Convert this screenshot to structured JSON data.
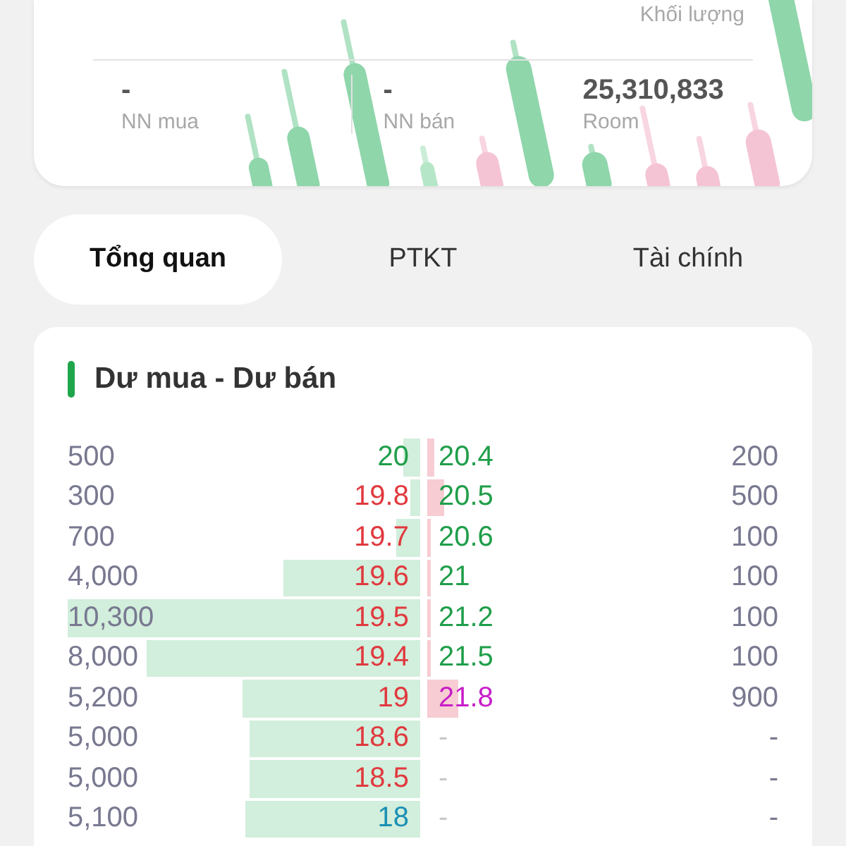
{
  "summary_card": {
    "volume_label": "Khối lượng",
    "stats": [
      {
        "value": "-",
        "label": "NN mua"
      },
      {
        "value": "-",
        "label": "NN bán"
      },
      {
        "value": "25,310,833",
        "label": "Room"
      }
    ]
  },
  "tabs": [
    {
      "label": "Tổng quan",
      "selected": true
    },
    {
      "label": "PTKT",
      "selected": false
    },
    {
      "label": "Tài chính",
      "selected": false
    }
  ],
  "order_book": {
    "title": "Dư mua - Dư bán",
    "rows": [
      {
        "bid": {
          "volume": "500",
          "price": "20",
          "color": "#1f9e4a"
        },
        "ask": {
          "price": "20.4",
          "color": "#1f9e4a",
          "volume": "200"
        }
      },
      {
        "bid": {
          "volume": "300",
          "price": "19.8",
          "color": "#e0393e"
        },
        "ask": {
          "price": "20.5",
          "color": "#1f9e4a",
          "volume": "500"
        }
      },
      {
        "bid": {
          "volume": "700",
          "price": "19.7",
          "color": "#e0393e"
        },
        "ask": {
          "price": "20.6",
          "color": "#1f9e4a",
          "volume": "100"
        }
      },
      {
        "bid": {
          "volume": "4,000",
          "price": "19.6",
          "color": "#e0393e"
        },
        "ask": {
          "price": "21",
          "color": "#1f9e4a",
          "volume": "100"
        }
      },
      {
        "bid": {
          "volume": "10,300",
          "price": "19.5",
          "color": "#e0393e"
        },
        "ask": {
          "price": "21.2",
          "color": "#1f9e4a",
          "volume": "100"
        }
      },
      {
        "bid": {
          "volume": "8,000",
          "price": "19.4",
          "color": "#e0393e"
        },
        "ask": {
          "price": "21.5",
          "color": "#1f9e4a",
          "volume": "100"
        }
      },
      {
        "bid": {
          "volume": "5,200",
          "price": "19",
          "color": "#e0393e"
        },
        "ask": {
          "price": "21.8",
          "color": "#c81ec8",
          "volume": "900"
        }
      },
      {
        "bid": {
          "volume": "5,000",
          "price": "18.6",
          "color": "#e0393e"
        },
        "ask": {
          "price": "-",
          "color": "#c8c8c8",
          "volume": "-"
        }
      },
      {
        "bid": {
          "volume": "5,000",
          "price": "18.5",
          "color": "#e0393e"
        },
        "ask": {
          "price": "-",
          "color": "#c8c8c8",
          "volume": "-"
        }
      },
      {
        "bid": {
          "volume": "5,100",
          "price": "18",
          "color": "#1a8fb5"
        },
        "ask": {
          "price": "-",
          "color": "#c8c8c8",
          "volume": "-"
        }
      }
    ]
  }
}
